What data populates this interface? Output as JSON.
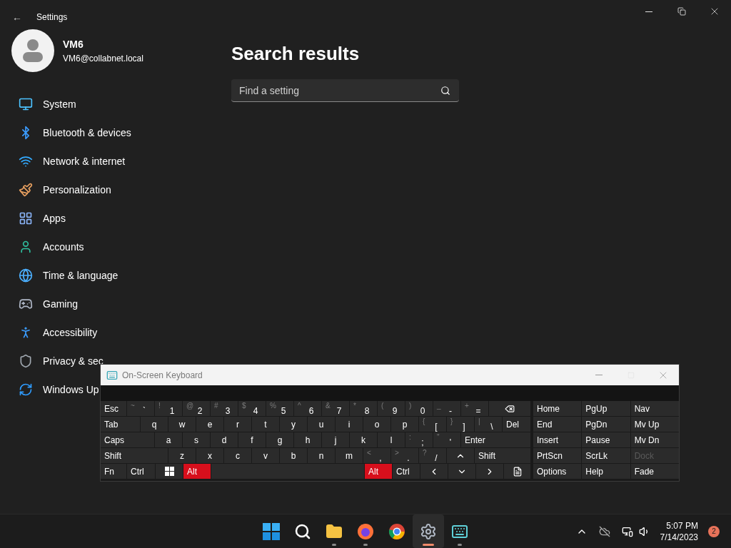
{
  "settings": {
    "back": "←",
    "title": "Settings",
    "profile": {
      "name": "VM6",
      "email": "VM6@collabnet.local"
    },
    "nav": [
      {
        "label": "System"
      },
      {
        "label": "Bluetooth & devices"
      },
      {
        "label": "Network & internet"
      },
      {
        "label": "Personalization"
      },
      {
        "label": "Apps"
      },
      {
        "label": "Accounts"
      },
      {
        "label": "Time & language"
      },
      {
        "label": "Gaming"
      },
      {
        "label": "Accessibility"
      },
      {
        "label": "Privacy & sec"
      },
      {
        "label": "Windows Up"
      }
    ],
    "heading": "Search results",
    "search": {
      "placeholder": "Find a setting"
    }
  },
  "keyboard": {
    "title": "On-Screen Keyboard",
    "rows": [
      {
        "keys": [
          {
            "kind": "text",
            "label": "Esc",
            "pressed": false
          },
          {
            "kind": "char",
            "label": "`",
            "shift": "~",
            "pressed": false
          },
          {
            "kind": "char",
            "label": "1",
            "shift": "!",
            "pressed": false
          },
          {
            "kind": "char",
            "label": "2",
            "shift": "@",
            "pressed": false
          },
          {
            "kind": "char",
            "label": "3",
            "shift": "#",
            "pressed": false
          },
          {
            "kind": "char",
            "label": "4",
            "shift": "$",
            "pressed": false
          },
          {
            "kind": "char",
            "label": "5",
            "shift": "%",
            "pressed": false
          },
          {
            "kind": "char",
            "label": "6",
            "shift": "^",
            "pressed": false
          },
          {
            "kind": "char",
            "label": "7",
            "shift": "&",
            "pressed": false
          },
          {
            "kind": "char",
            "label": "8",
            "shift": "*",
            "pressed": false
          },
          {
            "kind": "char",
            "label": "9",
            "shift": "(",
            "pressed": false
          },
          {
            "kind": "char",
            "label": "0",
            "shift": ")",
            "pressed": false
          },
          {
            "kind": "char",
            "label": "-",
            "shift": "_",
            "pressed": false
          },
          {
            "kind": "char",
            "label": "=",
            "shift": "+",
            "pressed": false
          },
          {
            "kind": "backspace",
            "pressed": false
          }
        ]
      },
      {
        "keys": [
          {
            "kind": "text",
            "label": "Tab",
            "pressed": false
          },
          {
            "kind": "char",
            "label": "q",
            "pressed": false
          },
          {
            "kind": "char",
            "label": "w",
            "pressed": false
          },
          {
            "kind": "char",
            "label": "e",
            "pressed": false
          },
          {
            "kind": "char",
            "label": "r",
            "pressed": false
          },
          {
            "kind": "char",
            "label": "t",
            "pressed": false
          },
          {
            "kind": "char",
            "label": "y",
            "pressed": false
          },
          {
            "kind": "char",
            "label": "u",
            "pressed": false
          },
          {
            "kind": "char",
            "label": "i",
            "pressed": false
          },
          {
            "kind": "char",
            "label": "o",
            "pressed": false
          },
          {
            "kind": "char",
            "label": "p",
            "pressed": false
          },
          {
            "kind": "char",
            "label": "[",
            "shift": "{",
            "pressed": false
          },
          {
            "kind": "char",
            "label": "]",
            "shift": "}",
            "pressed": false
          },
          {
            "kind": "char",
            "label": "\\",
            "shift": "|",
            "pressed": false
          },
          {
            "kind": "text",
            "label": "Del",
            "pressed": false
          }
        ]
      },
      {
        "keys": [
          {
            "kind": "text",
            "label": "Caps",
            "pressed": false
          },
          {
            "kind": "char",
            "label": "a",
            "pressed": false
          },
          {
            "kind": "char",
            "label": "s",
            "pressed": false
          },
          {
            "kind": "char",
            "label": "d",
            "pressed": false
          },
          {
            "kind": "char",
            "label": "f",
            "pressed": false
          },
          {
            "kind": "char",
            "label": "g",
            "pressed": false
          },
          {
            "kind": "char",
            "label": "h",
            "pressed": false
          },
          {
            "kind": "char",
            "label": "j",
            "pressed": false
          },
          {
            "kind": "char",
            "label": "k",
            "pressed": false
          },
          {
            "kind": "char",
            "label": "l",
            "pressed": false
          },
          {
            "kind": "char",
            "label": ";",
            "shift": ":",
            "pressed": false
          },
          {
            "kind": "char",
            "label": "'",
            "shift": "\"",
            "pressed": false
          },
          {
            "kind": "text",
            "label": "Enter",
            "pressed": false
          }
        ]
      },
      {
        "keys": [
          {
            "kind": "text",
            "label": "Shift",
            "pressed": false
          },
          {
            "kind": "char",
            "label": "z",
            "pressed": false
          },
          {
            "kind": "char",
            "label": "x",
            "pressed": false
          },
          {
            "kind": "char",
            "label": "c",
            "pressed": false
          },
          {
            "kind": "char",
            "label": "v",
            "pressed": false
          },
          {
            "kind": "char",
            "label": "b",
            "pressed": false
          },
          {
            "kind": "char",
            "label": "n",
            "pressed": false
          },
          {
            "kind": "char",
            "label": "m",
            "pressed": false
          },
          {
            "kind": "char",
            "label": ",",
            "shift": "<",
            "pressed": false
          },
          {
            "kind": "char",
            "label": ".",
            "shift": ">",
            "pressed": false
          },
          {
            "kind": "char",
            "label": "/",
            "shift": "?",
            "pressed": false
          },
          {
            "kind": "up",
            "pressed": false
          },
          {
            "kind": "text",
            "label": "Shift",
            "pressed": false
          }
        ]
      },
      {
        "keys": [
          {
            "kind": "text",
            "label": "Fn",
            "pressed": false
          },
          {
            "kind": "text",
            "label": "Ctrl",
            "pressed": false
          },
          {
            "kind": "windows",
            "pressed": false
          },
          {
            "kind": "text",
            "label": "Alt",
            "pressed": true
          },
          {
            "kind": "space",
            "pressed": false
          },
          {
            "kind": "text",
            "label": "Alt",
            "pressed": true
          },
          {
            "kind": "text",
            "label": "Ctrl",
            "pressed": false
          },
          {
            "kind": "left",
            "pressed": false
          },
          {
            "kind": "down",
            "pressed": false
          },
          {
            "kind": "right",
            "pressed": false
          },
          {
            "kind": "menu",
            "pressed": false
          }
        ]
      }
    ],
    "nav_keys": [
      {
        "label": "Home",
        "disabled": false
      },
      {
        "label": "PgUp",
        "disabled": false
      },
      {
        "label": "Nav",
        "disabled": false
      },
      {
        "label": "End",
        "disabled": false
      },
      {
        "label": "PgDn",
        "disabled": false
      },
      {
        "label": "Mv Up",
        "disabled": false
      },
      {
        "label": "Insert",
        "disabled": false
      },
      {
        "label": "Pause",
        "disabled": false
      },
      {
        "label": "Mv Dn",
        "disabled": false
      },
      {
        "label": "PrtScn",
        "disabled": false
      },
      {
        "label": "ScrLk",
        "disabled": false
      },
      {
        "label": "Dock",
        "disabled": true
      },
      {
        "label": "Options",
        "disabled": false
      },
      {
        "label": "Help",
        "disabled": false
      },
      {
        "label": "Fade",
        "disabled": false
      }
    ]
  },
  "taskbar": {
    "apps": [
      {
        "kind": "start",
        "running": false,
        "active": false
      },
      {
        "kind": "search",
        "running": false,
        "active": false
      },
      {
        "kind": "folder",
        "running": true,
        "active": false
      },
      {
        "kind": "firefox",
        "running": true,
        "active": false
      },
      {
        "kind": "chrome",
        "running": false,
        "active": false
      },
      {
        "kind": "settings",
        "running": true,
        "active": true
      },
      {
        "kind": "keyboard",
        "running": true,
        "active": false
      }
    ],
    "time": "5:07 PM",
    "date": "7/14/2023",
    "notifications": "2"
  }
}
